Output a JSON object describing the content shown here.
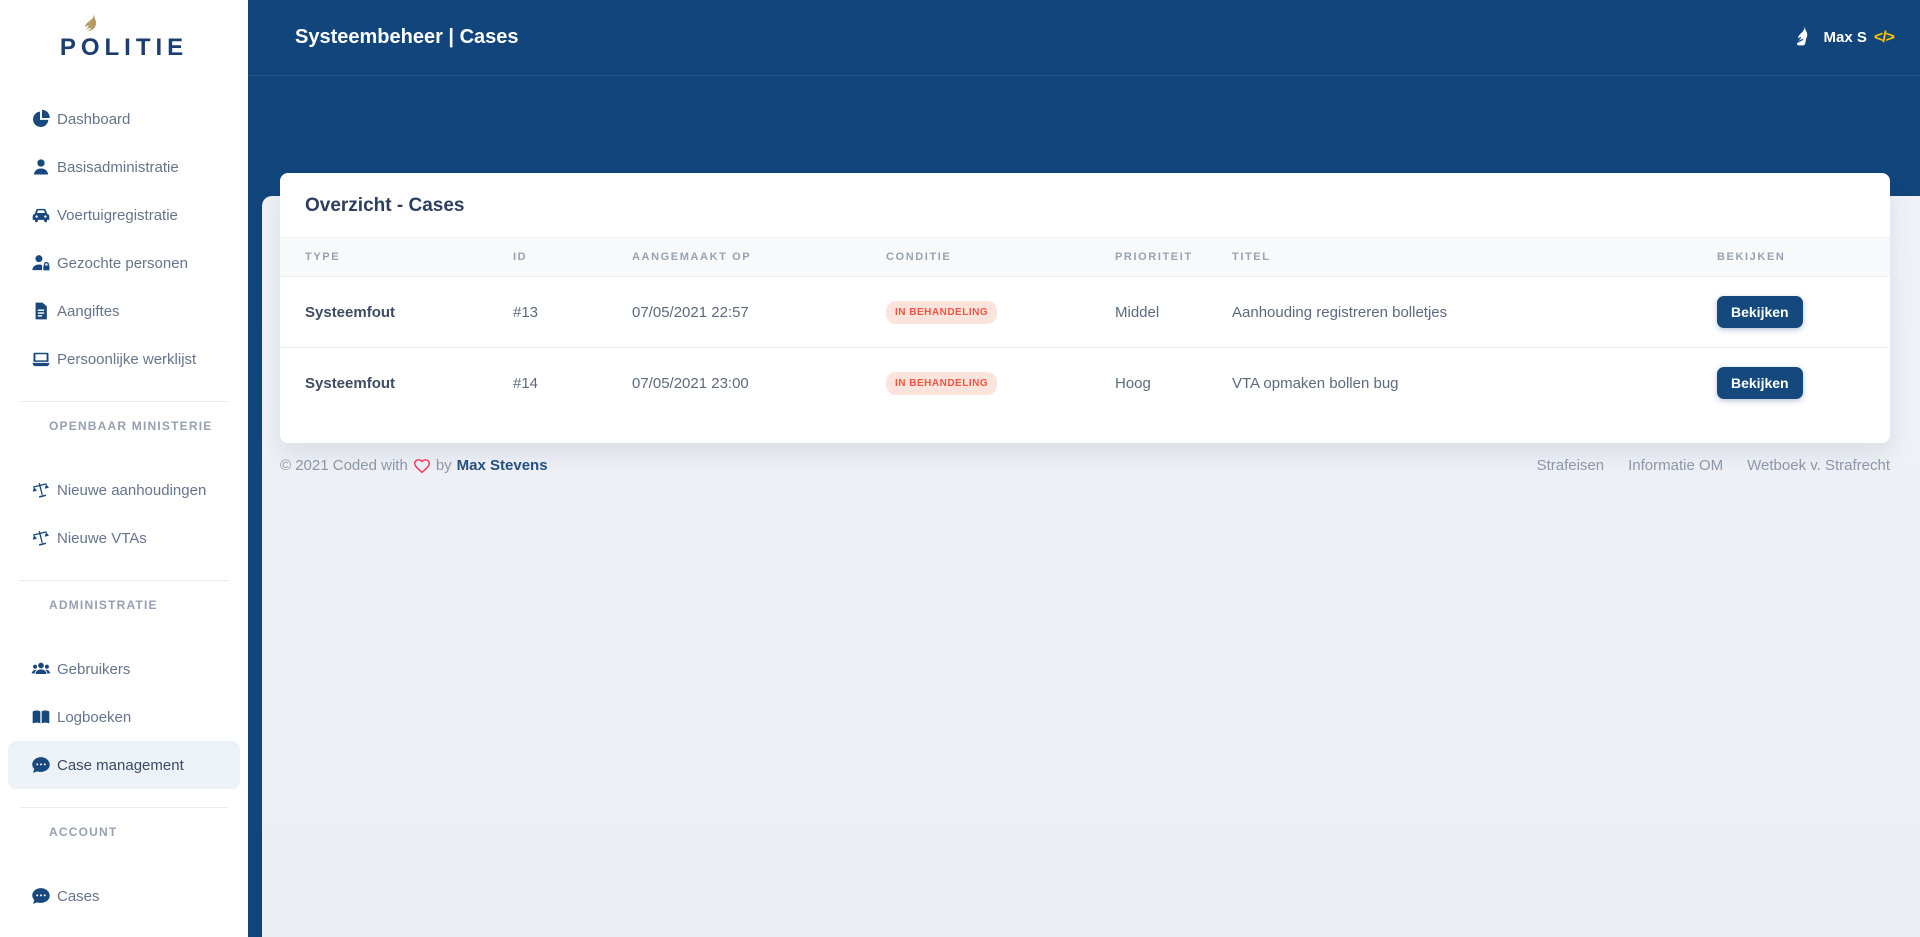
{
  "brand": {
    "p": "P",
    "o": "O",
    "rest": "LITIE"
  },
  "sidebar": {
    "main_items": [
      {
        "label": "Dashboard",
        "icon": "pie-chart"
      },
      {
        "label": "Basisadministratie",
        "icon": "user"
      },
      {
        "label": "Voertuigregistratie",
        "icon": "car"
      },
      {
        "label": "Gezochte personen",
        "icon": "user-lock"
      },
      {
        "label": "Aangiftes",
        "icon": "document"
      },
      {
        "label": "Persoonlijke werklijst",
        "icon": "laptop"
      }
    ],
    "sections": {
      "om": {
        "title": "OPENBAAR MINISTERIE",
        "items": [
          {
            "label": "Nieuwe aanhoudingen",
            "icon": "scales"
          },
          {
            "label": "Nieuwe VTAs",
            "icon": "scales"
          }
        ]
      },
      "admin": {
        "title": "ADMINISTRATIE",
        "items": [
          {
            "label": "Gebruikers",
            "icon": "users"
          },
          {
            "label": "Logboeken",
            "icon": "book-open"
          },
          {
            "label": "Case management",
            "icon": "comment-dots",
            "active": true
          }
        ]
      },
      "account": {
        "title": "ACCOUNT",
        "items": [
          {
            "label": "Cases",
            "icon": "comment-dots"
          }
        ]
      }
    }
  },
  "header": {
    "title": "Systeembeheer | Cases",
    "user_name": "Max S",
    "code_icon": "</>"
  },
  "card": {
    "title": "Overzicht - Cases"
  },
  "table": {
    "columns": [
      "TYPE",
      "ID",
      "AANGEMAAKT OP",
      "CONDITIE",
      "PRIORITEIT",
      "TITEL",
      "BEKIJKEN"
    ],
    "rows": [
      {
        "type": "Systeemfout",
        "id": "#13",
        "created": "07/05/2021 22:57",
        "condition": "IN BEHANDELING",
        "priority": "Middel",
        "title": "Aanhouding registreren bolletjes",
        "action": "Bekijken"
      },
      {
        "type": "Systeemfout",
        "id": "#14",
        "created": "07/05/2021 23:00",
        "condition": "IN BEHANDELING",
        "priority": "Hoog",
        "title": "VTA opmaken bollen bug",
        "action": "Bekijken"
      }
    ]
  },
  "footer": {
    "copyright": "© 2021 Coded with",
    "by": "by",
    "author": "Max Stevens",
    "links": [
      "Strafeisen",
      "Informatie OM",
      "Wetboek v. Strafrecht"
    ]
  },
  "colors": {
    "navy": "#11457c",
    "button_navy": "#15497e",
    "logo_gold": "#b79a5f",
    "badge_bg": "#fce4dd",
    "badge_text": "#f25540",
    "heart": "#f5365c",
    "code_icon_gold": "#fdc500",
    "active_item_bg": "#edf1f8",
    "page_bg": "#eff1f6"
  }
}
